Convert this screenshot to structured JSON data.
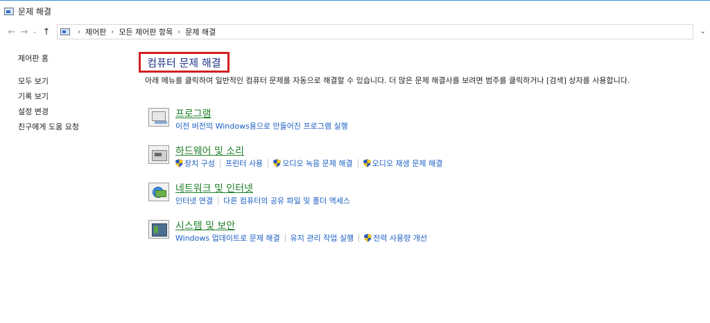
{
  "window": {
    "title": "문제 해결"
  },
  "address": {
    "crumbs": [
      "제어판",
      "모든 제어판 항목",
      "문제 해결"
    ]
  },
  "sidebar": {
    "home": "제어판 홈",
    "items": [
      "모두 보기",
      "기록 보기",
      "설정 변경",
      "친구에게 도움 요청"
    ]
  },
  "main": {
    "heading": "컴퓨터 문제 해결",
    "description": "아래 메뉴를 클릭하여 일반적인 컴퓨터 문제를 자동으로 해결할 수 있습니다. 더 많은 문제 해결사를 보려면 범주를 클릭하거나 [검색] 상자를 사용합니다.",
    "categories": [
      {
        "title": "프로그램",
        "icon": "program-icon",
        "links": [
          {
            "label": "이전 버전의 Windows용으로 만들어진 프로그램 실행",
            "shield": false
          }
        ]
      },
      {
        "title": "하드웨어 및 소리",
        "icon": "hardware-sound-icon",
        "links": [
          {
            "label": "장치 구성",
            "shield": true
          },
          {
            "label": "프린터 사용",
            "shield": false
          },
          {
            "label": "오디오 녹음 문제 해결",
            "shield": true
          },
          {
            "label": "오디오 재생 문제 해결",
            "shield": true
          }
        ]
      },
      {
        "title": "네트워크 및 인터넷",
        "icon": "network-internet-icon",
        "links": [
          {
            "label": "인터넷 연결",
            "shield": false
          },
          {
            "label": "다른 컴퓨터의 공유 파일 및 폴더 액세스",
            "shield": false
          }
        ]
      },
      {
        "title": "시스템 및 보안",
        "icon": "system-security-icon",
        "links": [
          {
            "label": "Windows 업데이트로 문제 해결",
            "shield": false
          },
          {
            "label": "유지 관리 작업 실행",
            "shield": false
          },
          {
            "label": "전력 사용량 개선",
            "shield": true
          }
        ]
      }
    ]
  },
  "colors": {
    "heading": "#1e3287",
    "category_title": "#1e7f28",
    "link": "#1a5ec2",
    "highlight_box": "#d31f1f"
  }
}
